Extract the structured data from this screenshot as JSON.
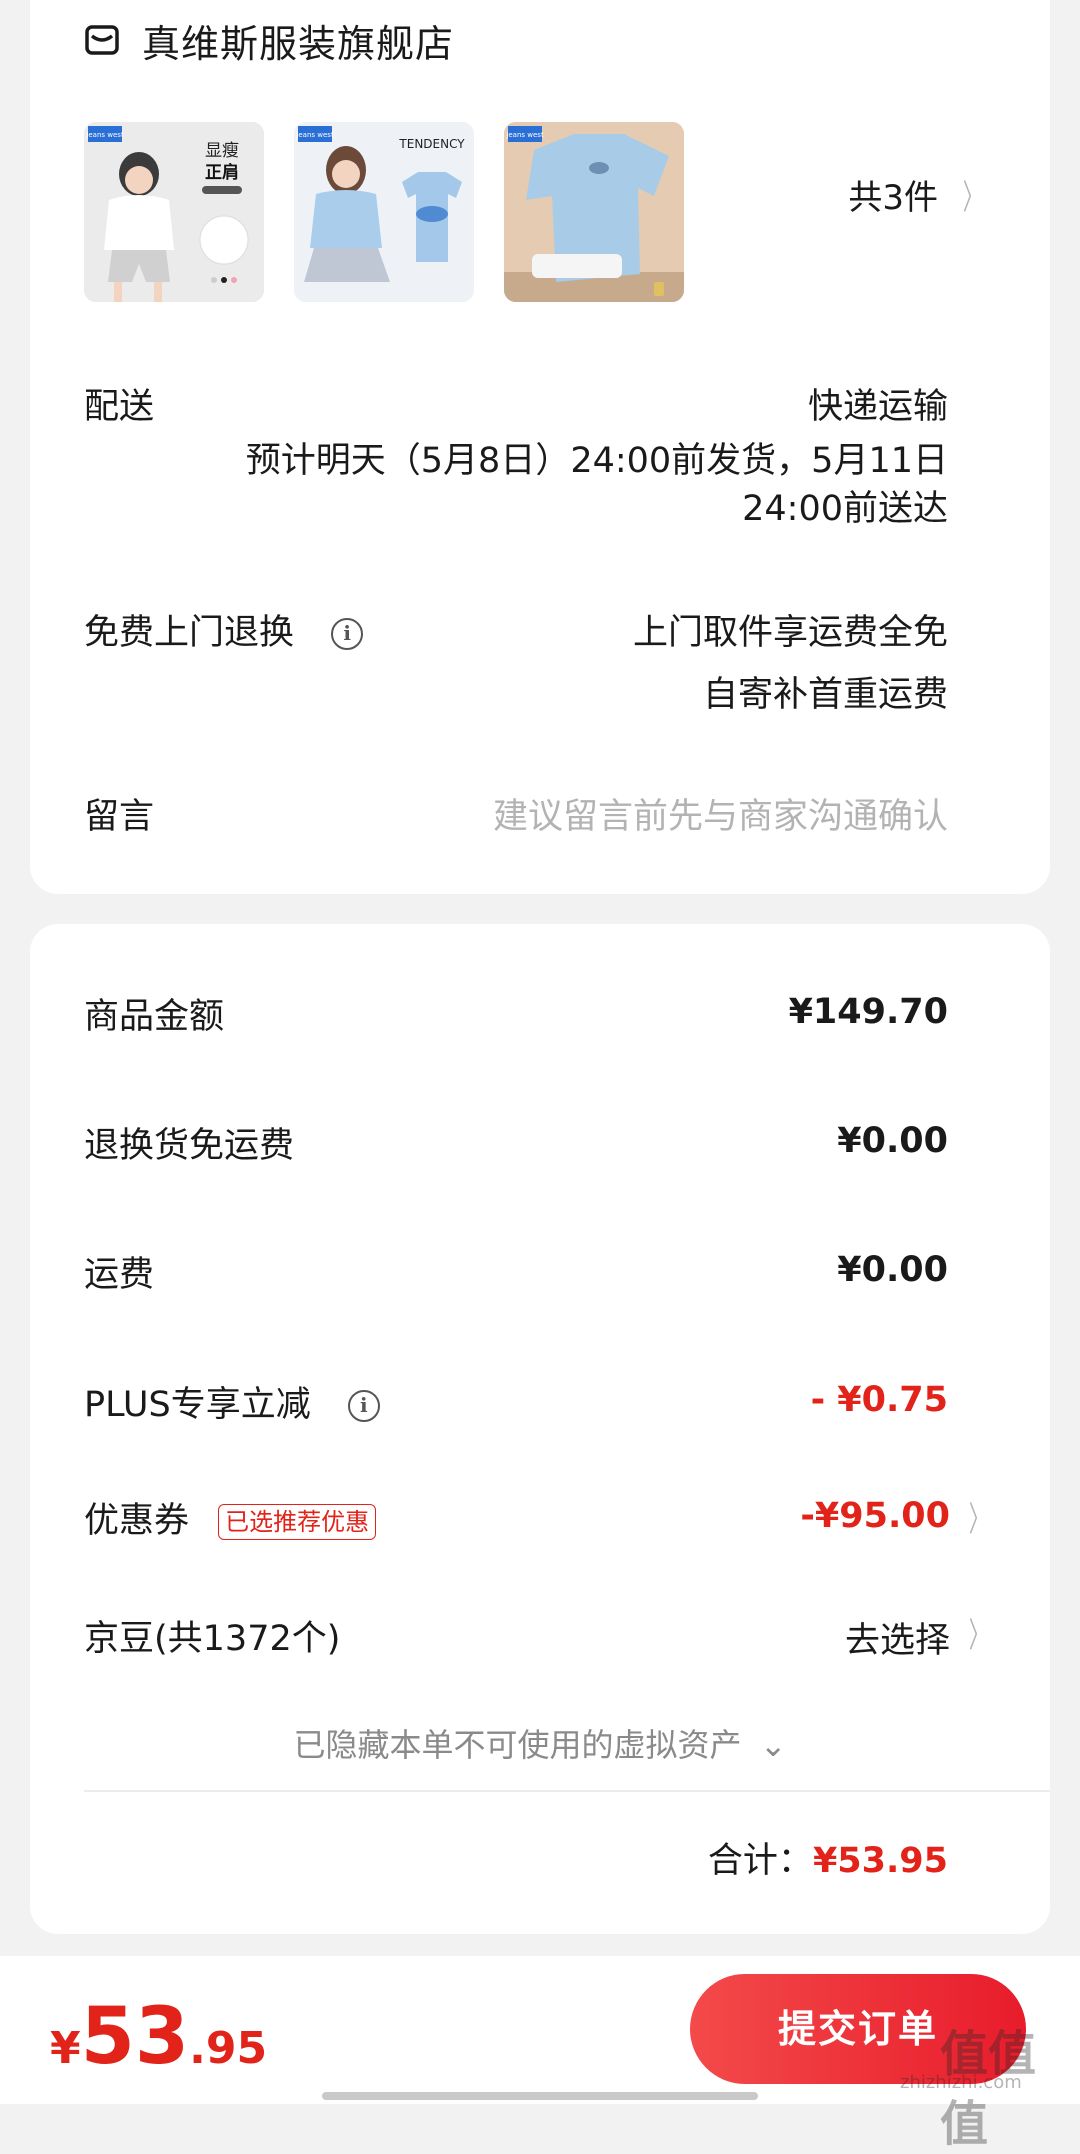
{
  "store": {
    "name": "真维斯服装旗舰店",
    "icon": "store-icon"
  },
  "products": {
    "thumbnails": [
      {
        "badge": "Jeans west",
        "text_1": "显瘦",
        "text_2": "正肩"
      },
      {
        "badge": "Jeans west",
        "text_1": "TENDENCY"
      },
      {
        "badge": "Jeans west"
      }
    ],
    "count_label": "共3件"
  },
  "delivery": {
    "label": "配送",
    "method": "快递运输",
    "estimate_line1": "预计明天（5月8日）24:00前发货，5月11日",
    "estimate_line2": "24:00前送达"
  },
  "return_service": {
    "label": "免费上门退换",
    "value_line1": "上门取件享运费全免",
    "value_line2": "自寄补首重运费"
  },
  "message": {
    "label": "留言",
    "placeholder": "建议留言前先与商家沟通确认"
  },
  "summary": {
    "goods_amount": {
      "label": "商品金额",
      "value": "¥149.70"
    },
    "return_free": {
      "label": "退换货免运费",
      "value": "¥0.00"
    },
    "shipping": {
      "label": "运费",
      "value": "¥0.00"
    },
    "plus_discount": {
      "label": "PLUS专享立减",
      "value": "- ¥0.75"
    },
    "coupon": {
      "label": "优惠券",
      "tag": "已选推荐优惠",
      "value": "-¥95.00"
    },
    "jingdou": {
      "label": "京豆(共1372个)",
      "value": "去选择"
    },
    "hidden_note": "已隐藏本单不可使用的虚拟资产",
    "total_label": "合计：",
    "total_value": "¥53.95"
  },
  "bottom_bar": {
    "currency": "¥",
    "price_int": "53",
    "price_dec": ".95",
    "submit_label": "提交订单"
  },
  "watermark": {
    "text": "值值值",
    "sub": "zhizhizhi.com"
  },
  "colors": {
    "accent_red": "#e2231a",
    "background": "#f2f2f2"
  }
}
